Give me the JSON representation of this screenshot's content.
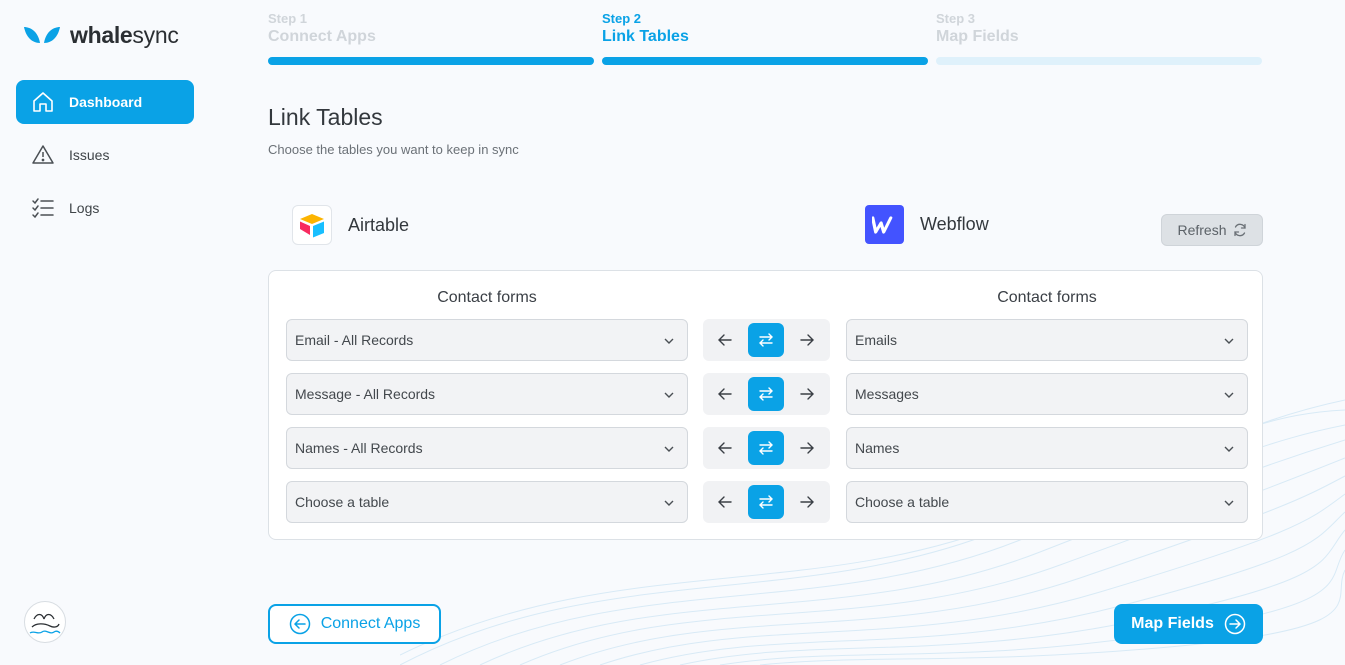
{
  "brand": {
    "name_bold": "whale",
    "name_light": "sync",
    "accent": "#0aa2e6"
  },
  "sidebar": {
    "items": [
      {
        "label": "Dashboard",
        "icon": "home-icon",
        "active": true
      },
      {
        "label": "Issues",
        "icon": "warning-icon",
        "active": false
      },
      {
        "label": "Logs",
        "icon": "checklist-icon",
        "active": false
      }
    ]
  },
  "steps": [
    {
      "num": "Step 1",
      "name": "Connect Apps",
      "state": "done"
    },
    {
      "num": "Step 2",
      "name": "Link Tables",
      "state": "current"
    },
    {
      "num": "Step 3",
      "name": "Map Fields",
      "state": "upcoming"
    }
  ],
  "page": {
    "title": "Link Tables",
    "subtitle": "Choose the tables you want to keep in sync"
  },
  "apps": {
    "left": {
      "name": "Airtable",
      "icon": "airtable-logo-icon",
      "base": "Contact forms"
    },
    "right": {
      "name": "Webflow",
      "icon": "webflow-logo-icon",
      "base": "Contact forms"
    }
  },
  "refresh_label": "Refresh",
  "rows": [
    {
      "left": "Email - All Records",
      "right": "Emails",
      "direction": "both"
    },
    {
      "left": "Message - All Records",
      "right": "Messages",
      "direction": "both"
    },
    {
      "left": "Names - All Records",
      "right": "Names",
      "direction": "both"
    },
    {
      "left": "Choose a table",
      "right": "Choose a table",
      "direction": "both"
    }
  ],
  "footer": {
    "back_label": "Connect Apps",
    "next_label": "Map Fields"
  }
}
